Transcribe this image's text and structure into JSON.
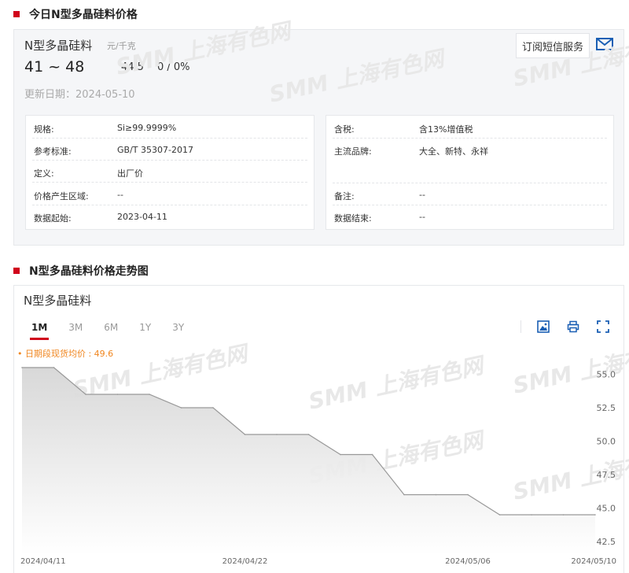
{
  "section1": {
    "title": "今日N型多晶硅料价格"
  },
  "product": {
    "name": "N型多晶硅料",
    "unit": "元/千克",
    "range": "41 ~ 48",
    "avg": "44.5",
    "change": "0 / 0%",
    "update": "更新日期：2024-05-10",
    "subscribe_label": "订阅短信服务",
    "mail_icon": "mail-icon"
  },
  "specs_left": [
    {
      "key": "规格:",
      "value": "Si≥99.9999%"
    },
    {
      "key": "参考标准:",
      "value": "GB/T 35307-2017"
    },
    {
      "key": "定义:",
      "value": "出厂价"
    },
    {
      "key": "价格产生区域:",
      "value": "--"
    },
    {
      "key": "数据起始:",
      "value": "2023-04-11"
    }
  ],
  "specs_right": [
    {
      "key": "含税:",
      "value": "含13%增值税"
    },
    {
      "key": "主流品牌:",
      "value": "大全、新特、永祥"
    },
    {
      "key": "备注:",
      "value": "--"
    },
    {
      "key": "数据结束:",
      "value": "--"
    }
  ],
  "section2": {
    "title": "N型多晶硅料价格走势图"
  },
  "chart_panel": {
    "name": "N型多晶硅料",
    "tabs": [
      "1M",
      "3M",
      "6M",
      "1Y",
      "3Y"
    ],
    "active_tab": "1M",
    "avg_label": "• 日期段现货均价 : 49.6",
    "tools": [
      "image-icon",
      "print-icon",
      "fullscreen-icon"
    ]
  },
  "watermark": "SMM 上海有色网",
  "colors": {
    "accent": "#d0021b",
    "avg_label": "#f0861f",
    "line": "#999999"
  },
  "chart_data": {
    "type": "area",
    "title": "",
    "ylim": [
      41.5,
      56.5
    ],
    "y_ticks": [
      "55.0",
      "52.5",
      "50.0",
      "47.5",
      "45.0",
      "42.5"
    ],
    "x_ticks": [
      "2024/04/11",
      "2024/04/22",
      "2024/05/06",
      "2024/05/10"
    ],
    "x": [
      "2024/04/11",
      "2024/04/12",
      "2024/04/15",
      "2024/04/16",
      "2024/04/17",
      "2024/04/18",
      "2024/04/19",
      "2024/04/22",
      "2024/04/23",
      "2024/04/24",
      "2024/04/25",
      "2024/04/26",
      "2024/04/29",
      "2024/04/30",
      "2024/05/06",
      "2024/05/07",
      "2024/05/08",
      "2024/05/09",
      "2024/05/10"
    ],
    "series": [
      {
        "values": [
          55.5,
          55.5,
          53.5,
          53.5,
          53.5,
          52.5,
          52.5,
          50.5,
          50.5,
          50.5,
          49.0,
          49.0,
          46.0,
          46.0,
          46.0,
          44.5,
          44.5,
          44.5,
          44.5
        ]
      }
    ]
  }
}
